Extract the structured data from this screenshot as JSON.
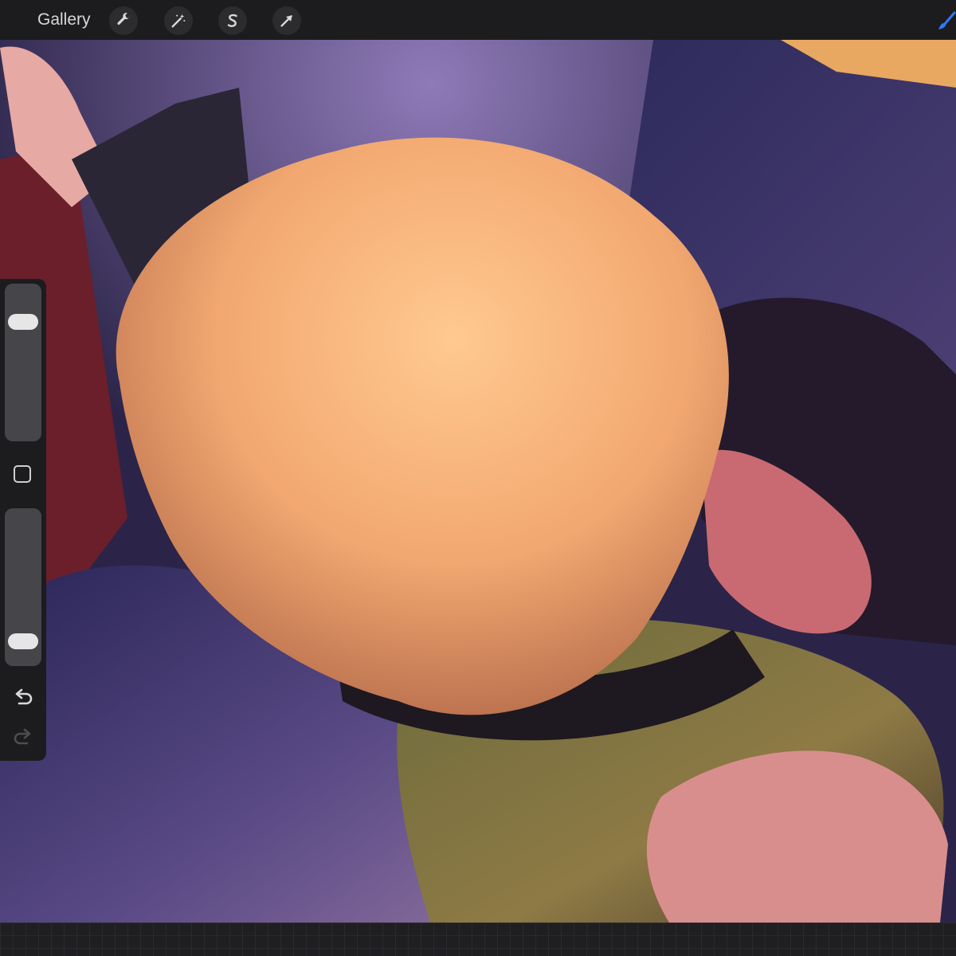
{
  "toolbar": {
    "gallery_label": "Gallery",
    "actions_icon": "wrench-icon",
    "adjustments_icon": "magic-wand-icon",
    "selection_icon": "selection-s-icon",
    "transform_icon": "arrow-cursor-icon",
    "brush_icon": "brush-icon",
    "accent_color": "#2f7bf6"
  },
  "sidebar": {
    "brush_size_level": 0.8,
    "opacity_level": 0.1,
    "modify_icon": "square-icon",
    "undo_icon": "undo-arrow-icon",
    "redo_icon": "redo-arrow-icon"
  }
}
